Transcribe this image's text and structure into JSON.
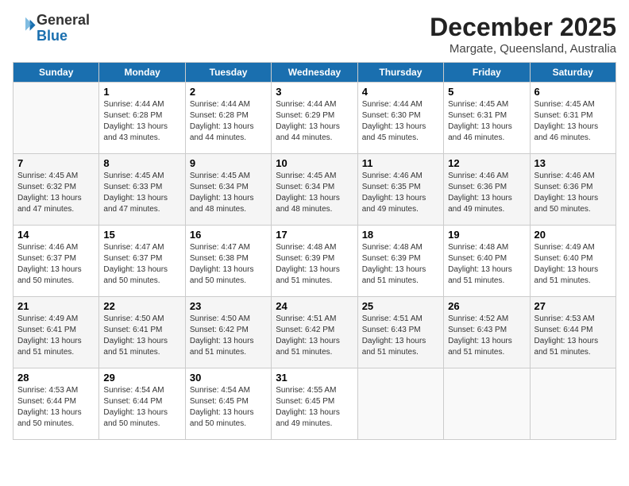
{
  "logo": {
    "line1": "General",
    "line2": "Blue"
  },
  "title": "December 2025",
  "location": "Margate, Queensland, Australia",
  "weekdays": [
    "Sunday",
    "Monday",
    "Tuesday",
    "Wednesday",
    "Thursday",
    "Friday",
    "Saturday"
  ],
  "weeks": [
    [
      {
        "day": "",
        "sunrise": "",
        "sunset": "",
        "daylight": ""
      },
      {
        "day": "1",
        "sunrise": "Sunrise: 4:44 AM",
        "sunset": "Sunset: 6:28 PM",
        "daylight": "Daylight: 13 hours and 43 minutes."
      },
      {
        "day": "2",
        "sunrise": "Sunrise: 4:44 AM",
        "sunset": "Sunset: 6:28 PM",
        "daylight": "Daylight: 13 hours and 44 minutes."
      },
      {
        "day": "3",
        "sunrise": "Sunrise: 4:44 AM",
        "sunset": "Sunset: 6:29 PM",
        "daylight": "Daylight: 13 hours and 44 minutes."
      },
      {
        "day": "4",
        "sunrise": "Sunrise: 4:44 AM",
        "sunset": "Sunset: 6:30 PM",
        "daylight": "Daylight: 13 hours and 45 minutes."
      },
      {
        "day": "5",
        "sunrise": "Sunrise: 4:45 AM",
        "sunset": "Sunset: 6:31 PM",
        "daylight": "Daylight: 13 hours and 46 minutes."
      },
      {
        "day": "6",
        "sunrise": "Sunrise: 4:45 AM",
        "sunset": "Sunset: 6:31 PM",
        "daylight": "Daylight: 13 hours and 46 minutes."
      }
    ],
    [
      {
        "day": "7",
        "sunrise": "Sunrise: 4:45 AM",
        "sunset": "Sunset: 6:32 PM",
        "daylight": "Daylight: 13 hours and 47 minutes."
      },
      {
        "day": "8",
        "sunrise": "Sunrise: 4:45 AM",
        "sunset": "Sunset: 6:33 PM",
        "daylight": "Daylight: 13 hours and 47 minutes."
      },
      {
        "day": "9",
        "sunrise": "Sunrise: 4:45 AM",
        "sunset": "Sunset: 6:34 PM",
        "daylight": "Daylight: 13 hours and 48 minutes."
      },
      {
        "day": "10",
        "sunrise": "Sunrise: 4:45 AM",
        "sunset": "Sunset: 6:34 PM",
        "daylight": "Daylight: 13 hours and 48 minutes."
      },
      {
        "day": "11",
        "sunrise": "Sunrise: 4:46 AM",
        "sunset": "Sunset: 6:35 PM",
        "daylight": "Daylight: 13 hours and 49 minutes."
      },
      {
        "day": "12",
        "sunrise": "Sunrise: 4:46 AM",
        "sunset": "Sunset: 6:36 PM",
        "daylight": "Daylight: 13 hours and 49 minutes."
      },
      {
        "day": "13",
        "sunrise": "Sunrise: 4:46 AM",
        "sunset": "Sunset: 6:36 PM",
        "daylight": "Daylight: 13 hours and 50 minutes."
      }
    ],
    [
      {
        "day": "14",
        "sunrise": "Sunrise: 4:46 AM",
        "sunset": "Sunset: 6:37 PM",
        "daylight": "Daylight: 13 hours and 50 minutes."
      },
      {
        "day": "15",
        "sunrise": "Sunrise: 4:47 AM",
        "sunset": "Sunset: 6:37 PM",
        "daylight": "Daylight: 13 hours and 50 minutes."
      },
      {
        "day": "16",
        "sunrise": "Sunrise: 4:47 AM",
        "sunset": "Sunset: 6:38 PM",
        "daylight": "Daylight: 13 hours and 50 minutes."
      },
      {
        "day": "17",
        "sunrise": "Sunrise: 4:48 AM",
        "sunset": "Sunset: 6:39 PM",
        "daylight": "Daylight: 13 hours and 51 minutes."
      },
      {
        "day": "18",
        "sunrise": "Sunrise: 4:48 AM",
        "sunset": "Sunset: 6:39 PM",
        "daylight": "Daylight: 13 hours and 51 minutes."
      },
      {
        "day": "19",
        "sunrise": "Sunrise: 4:48 AM",
        "sunset": "Sunset: 6:40 PM",
        "daylight": "Daylight: 13 hours and 51 minutes."
      },
      {
        "day": "20",
        "sunrise": "Sunrise: 4:49 AM",
        "sunset": "Sunset: 6:40 PM",
        "daylight": "Daylight: 13 hours and 51 minutes."
      }
    ],
    [
      {
        "day": "21",
        "sunrise": "Sunrise: 4:49 AM",
        "sunset": "Sunset: 6:41 PM",
        "daylight": "Daylight: 13 hours and 51 minutes."
      },
      {
        "day": "22",
        "sunrise": "Sunrise: 4:50 AM",
        "sunset": "Sunset: 6:41 PM",
        "daylight": "Daylight: 13 hours and 51 minutes."
      },
      {
        "day": "23",
        "sunrise": "Sunrise: 4:50 AM",
        "sunset": "Sunset: 6:42 PM",
        "daylight": "Daylight: 13 hours and 51 minutes."
      },
      {
        "day": "24",
        "sunrise": "Sunrise: 4:51 AM",
        "sunset": "Sunset: 6:42 PM",
        "daylight": "Daylight: 13 hours and 51 minutes."
      },
      {
        "day": "25",
        "sunrise": "Sunrise: 4:51 AM",
        "sunset": "Sunset: 6:43 PM",
        "daylight": "Daylight: 13 hours and 51 minutes."
      },
      {
        "day": "26",
        "sunrise": "Sunrise: 4:52 AM",
        "sunset": "Sunset: 6:43 PM",
        "daylight": "Daylight: 13 hours and 51 minutes."
      },
      {
        "day": "27",
        "sunrise": "Sunrise: 4:53 AM",
        "sunset": "Sunset: 6:44 PM",
        "daylight": "Daylight: 13 hours and 51 minutes."
      }
    ],
    [
      {
        "day": "28",
        "sunrise": "Sunrise: 4:53 AM",
        "sunset": "Sunset: 6:44 PM",
        "daylight": "Daylight: 13 hours and 50 minutes."
      },
      {
        "day": "29",
        "sunrise": "Sunrise: 4:54 AM",
        "sunset": "Sunset: 6:44 PM",
        "daylight": "Daylight: 13 hours and 50 minutes."
      },
      {
        "day": "30",
        "sunrise": "Sunrise: 4:54 AM",
        "sunset": "Sunset: 6:45 PM",
        "daylight": "Daylight: 13 hours and 50 minutes."
      },
      {
        "day": "31",
        "sunrise": "Sunrise: 4:55 AM",
        "sunset": "Sunset: 6:45 PM",
        "daylight": "Daylight: 13 hours and 49 minutes."
      },
      {
        "day": "",
        "sunrise": "",
        "sunset": "",
        "daylight": ""
      },
      {
        "day": "",
        "sunrise": "",
        "sunset": "",
        "daylight": ""
      },
      {
        "day": "",
        "sunrise": "",
        "sunset": "",
        "daylight": ""
      }
    ]
  ]
}
